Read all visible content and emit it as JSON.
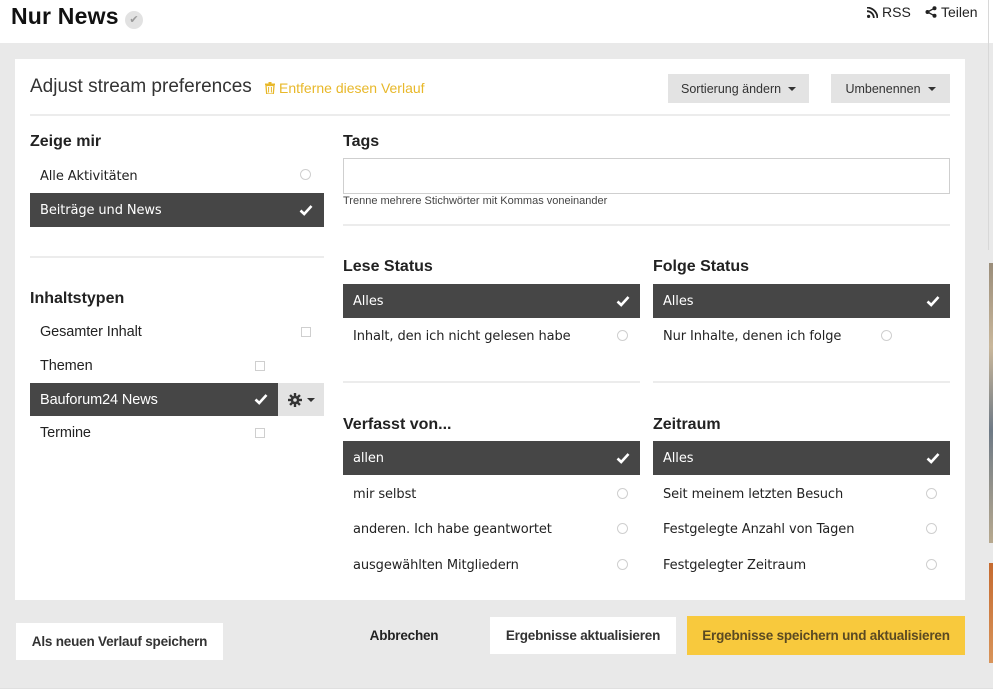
{
  "header": {
    "title": "Nur News",
    "rss_label": "RSS",
    "share_label": "Teilen"
  },
  "panel": {
    "title": "Adjust stream preferences",
    "remove_label": "Entferne diesen Verlauf",
    "sort_label": "Sortierung ändern",
    "rename_label": "Umbenennen"
  },
  "show_me": {
    "heading": "Zeige mir",
    "options": [
      {
        "label": "Alle Aktivitäten",
        "selected": false
      },
      {
        "label": "Beiträge und News",
        "selected": true
      }
    ]
  },
  "content_types": {
    "heading": "Inhaltstypen",
    "options": [
      {
        "label": "Gesamter Inhalt",
        "selected": false
      },
      {
        "label": "Themen",
        "selected": false
      },
      {
        "label": "Bauforum24 News",
        "selected": true
      },
      {
        "label": "Termine",
        "selected": false
      }
    ]
  },
  "tags": {
    "heading": "Tags",
    "value": "",
    "placeholder": "",
    "help": "Trenne mehrere Stichwörter mit Kommas voneinander"
  },
  "read_status": {
    "heading": "Lese Status",
    "options": [
      {
        "label": "Alles",
        "selected": true
      },
      {
        "label": "Inhalt, den ich nicht gelesen habe",
        "selected": false
      }
    ]
  },
  "follow_status": {
    "heading": "Folge Status",
    "options": [
      {
        "label": "Alles",
        "selected": true
      },
      {
        "label": "Nur Inhalte, denen ich folge",
        "selected": false
      }
    ]
  },
  "authored_by": {
    "heading": "Verfasst von...",
    "options": [
      {
        "label": "allen",
        "selected": true
      },
      {
        "label": "mir selbst",
        "selected": false
      },
      {
        "label": "anderen. Ich habe geantwortet",
        "selected": false
      },
      {
        "label": "ausgewählten Mitgliedern",
        "selected": false
      }
    ]
  },
  "time_range": {
    "heading": "Zeitraum",
    "options": [
      {
        "label": "Alles",
        "selected": true
      },
      {
        "label": "Seit meinem letzten Besuch",
        "selected": false
      },
      {
        "label": "Festgelegte Anzahl von Tagen",
        "selected": false
      },
      {
        "label": "Festgelegter Zeitraum",
        "selected": false
      }
    ]
  },
  "footer": {
    "save_new_label": "Als neuen Verlauf speichern",
    "cancel_label": "Abbrechen",
    "update_label": "Ergebnisse aktualisieren",
    "save_update_label": "Ergebnisse speichern und aktualisieren"
  },
  "colors": {
    "selected_bg": "#464646",
    "accent_yellow": "#f8c93d",
    "remove_link": "#e8b82a",
    "page_bg": "#e9e9e9"
  },
  "icons": {
    "title_badge": "check-circle-icon",
    "rss": "rss-icon",
    "share": "share-icon",
    "remove": "trash-icon",
    "selected_marker": "checkmark-icon",
    "content_settings": "gear-icon"
  }
}
